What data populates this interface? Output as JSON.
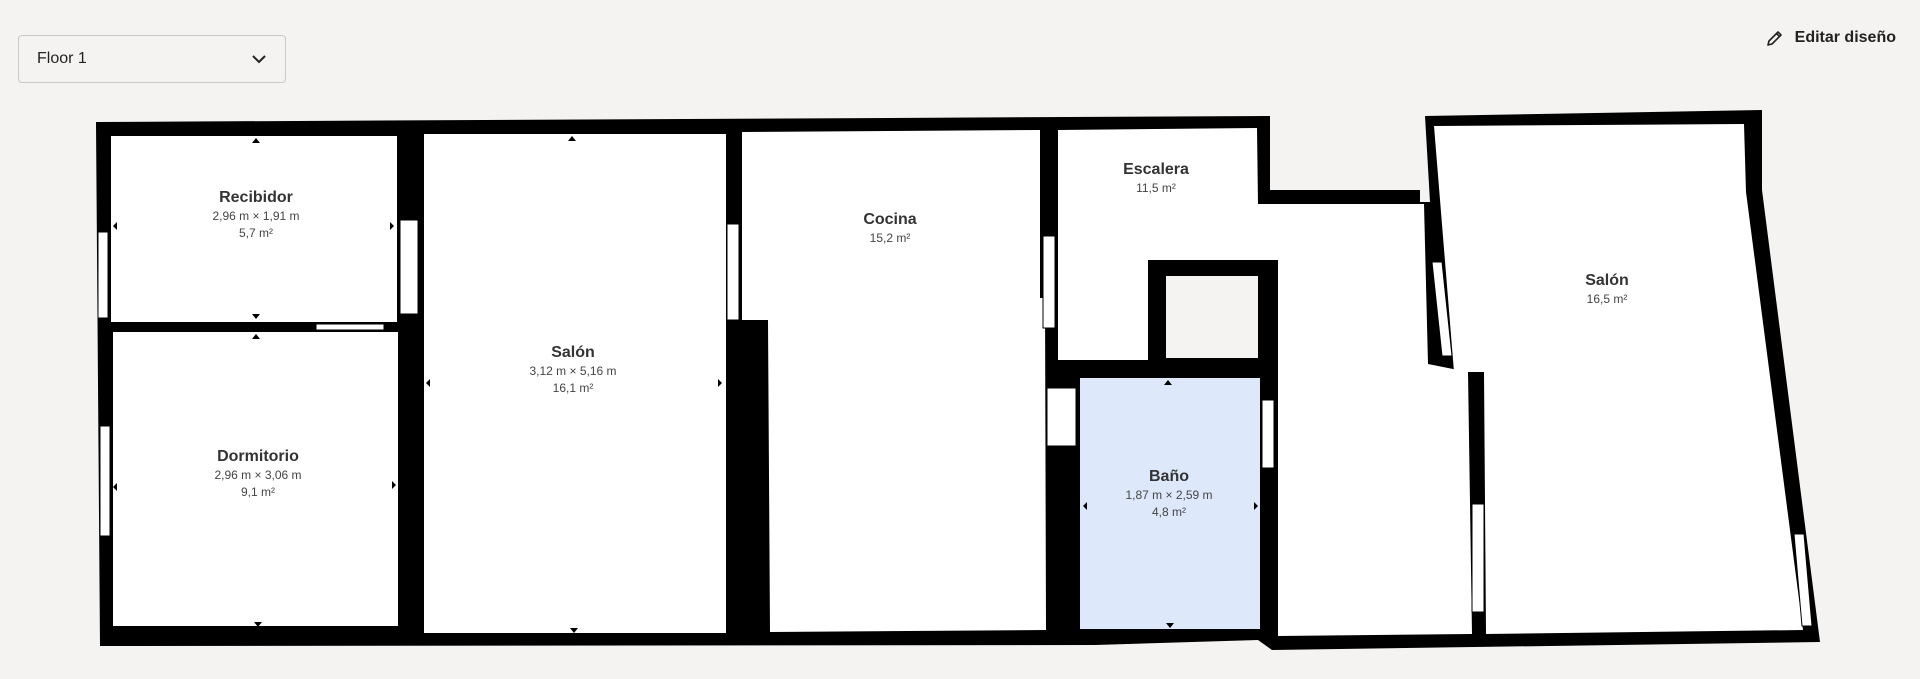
{
  "floor_selector": {
    "value": "Floor 1"
  },
  "edit_button": {
    "label": "Editar diseño",
    "icon": "pencil-icon"
  },
  "rooms": {
    "recibidor": {
      "name": "Recibidor",
      "dims": "2,96 m × 1,91 m",
      "area": "5,7 m²"
    },
    "dormitorio": {
      "name": "Dormitorio",
      "dims": "2,96 m × 3,06 m",
      "area": "9,1 m²"
    },
    "salon_main": {
      "name": "Salón",
      "dims": "3,12 m × 5,16 m",
      "area": "16,1 m²"
    },
    "cocina": {
      "name": "Cocina",
      "area": "15,2 m²"
    },
    "escalera": {
      "name": "Escalera",
      "area": "11,5 m²"
    },
    "bano": {
      "name": "Baño",
      "dims": "1,87 m × 2,59 m",
      "area": "4,8 m²"
    },
    "salon_right": {
      "name": "Salón",
      "area": "16,5 m²"
    }
  },
  "colors": {
    "background": "#f4f3f1",
    "wall": "#000000",
    "room_fill": "#ffffff",
    "selected_room": "#dde9fb"
  }
}
